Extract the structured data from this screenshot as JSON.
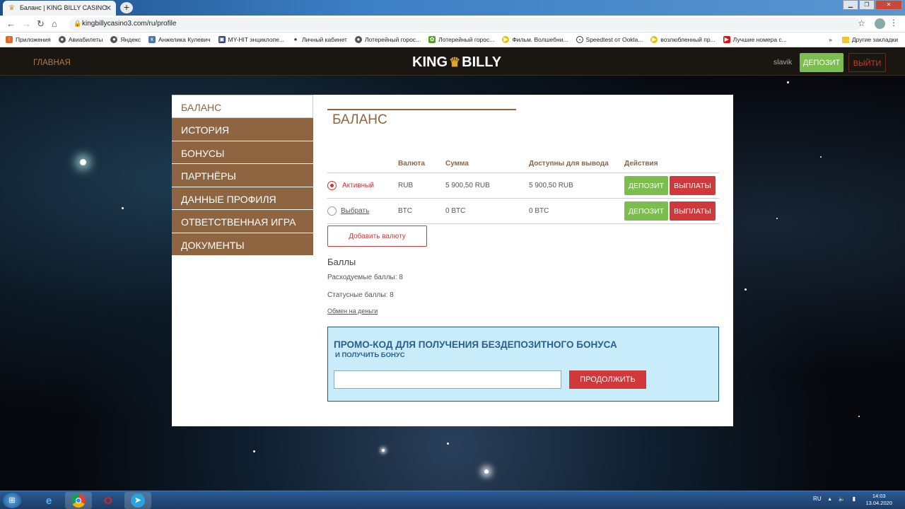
{
  "browser": {
    "tab_title": "Баланс | KING BILLY CASINO",
    "url": "kingbillycasino3.com/ru/profile",
    "bookmarks": [
      "Приложения",
      "Авиабилеты",
      "Яндекс",
      "Анжелика Кулевич",
      "MY-HIT энциклопе...",
      "Личный кабинет",
      "Лотерейный горос...",
      "Лотерейный горос...",
      "Фильм. Волшебни...",
      "Speedtest от Ookla...",
      "возлюбленный пр...",
      "Лучшие номера с..."
    ],
    "other_bookmarks": "Другие закладки"
  },
  "header": {
    "home": "ГЛАВНАЯ",
    "logo_left": "KING",
    "logo_right": "BILLY",
    "user": "slavik",
    "deposit": "ДЕПОЗИТ",
    "logout": "ВЫЙТИ"
  },
  "menu": [
    "БАЛАНС",
    "ИСТОРИЯ",
    "БОНУСЫ",
    "ПАРТНЁРЫ",
    "ДАННЫЕ ПРОФИЛЯ",
    "ОТВЕТСТВЕННАЯ ИГРА",
    "ДОКУМЕНТЫ"
  ],
  "balance": {
    "title": "БАЛАНС",
    "columns": [
      "Валюта",
      "Сумма",
      "Доступны для вывода",
      "Действия"
    ],
    "rows": [
      {
        "status": "Активный",
        "currency": "RUB",
        "amount": "5 900,50 RUB",
        "withdrawable": "5 900,50 RUB",
        "selected": true
      },
      {
        "status": "Выбрать",
        "currency": "BTC",
        "amount": "0 BTC",
        "withdrawable": "0 BTC",
        "selected": false
      }
    ],
    "deposit_btn": "ДЕПОЗИТ",
    "payout_btn": "ВЫПЛАТЫ",
    "add_currency": "Добавить валюту"
  },
  "points": {
    "heading": "Баллы",
    "spendable": "Расходуемые баллы: 8",
    "status": "Статусные баллы: 8",
    "exchange": "Обмен на деньги"
  },
  "promo": {
    "heading": "ПРОМО-КОД ДЛЯ ПОЛУЧЕНИЯ БЕЗДЕПОЗИТНОГО БОНУСА",
    "sub": "И ПОЛУЧИТЬ БОНУС",
    "input_value": "",
    "button": "ПРОДОЛЖИТЬ"
  },
  "taskbar": {
    "lang": "RU",
    "time": "14:03",
    "date": "13.04.2020"
  },
  "colors": {
    "accent": "#8e6441",
    "green": "#7bbd4e",
    "red": "#d0393b",
    "promo_bg": "#c9ecfb"
  }
}
